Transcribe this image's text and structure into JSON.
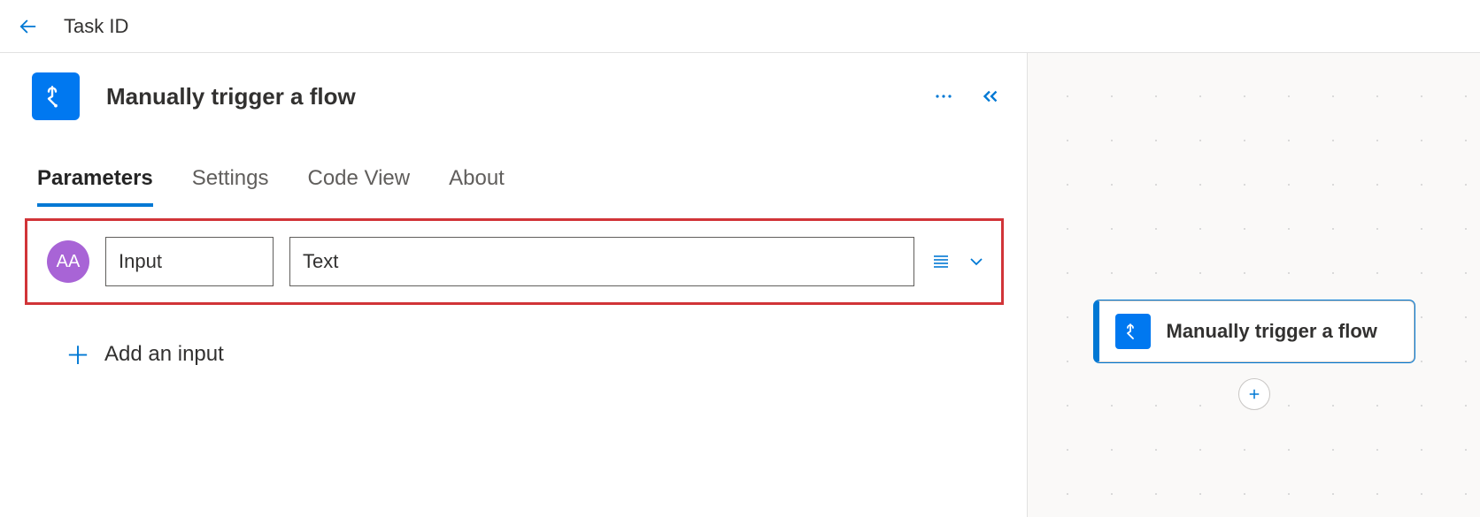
{
  "topbar": {
    "title": "Task ID"
  },
  "panel": {
    "title": "Manually trigger a flow",
    "tabs": [
      {
        "label": "Parameters",
        "active": true
      },
      {
        "label": "Settings",
        "active": false
      },
      {
        "label": "Code View",
        "active": false
      },
      {
        "label": "About",
        "active": false
      }
    ],
    "input": {
      "badge": "AA",
      "name": "Input",
      "value": "Text"
    },
    "add_input_label": "Add an input"
  },
  "canvas": {
    "card_title": "Manually trigger a flow"
  }
}
